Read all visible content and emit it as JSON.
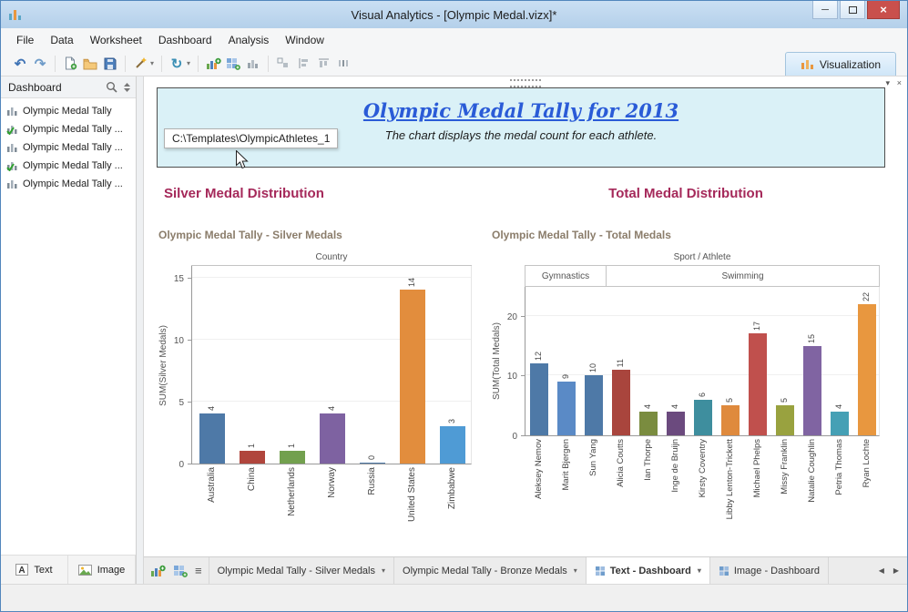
{
  "window": {
    "title": "Visual Analytics - [Olympic Medal.vizx]*"
  },
  "icons": {
    "caret_down": "▾",
    "minimize": "─",
    "close": "×",
    "undo": "↶",
    "redo": "↷",
    "refresh": "↻",
    "nav_left": "◀",
    "nav_right": "▶",
    "list": "≡"
  },
  "menu": {
    "items": [
      "File",
      "Data",
      "Worksheet",
      "Dashboard",
      "Analysis",
      "Window"
    ]
  },
  "toolbar": {
    "visualization_label": "Visualization"
  },
  "sidebar": {
    "title": "Dashboard",
    "items": [
      {
        "label": "Olympic Medal Tally",
        "checked": false
      },
      {
        "label": "Olympic Medal Tally ...",
        "checked": true
      },
      {
        "label": "Olympic Medal Tally ...",
        "checked": false
      },
      {
        "label": "Olympic Medal Tally ...",
        "checked": true
      },
      {
        "label": "Olympic Medal Tally ...",
        "checked": false
      }
    ],
    "footer": {
      "text_button": "Text",
      "image_button": "Image"
    }
  },
  "dashboard": {
    "text_widget": {
      "title": "Olympic Medal Tally for 2013",
      "subtitle": "The chart displays the medal count for each athlete."
    },
    "tooltip": "C:\\Templates\\OlympicAthletes_1",
    "sections": [
      {
        "heading": "Silver Medal Distribution"
      },
      {
        "heading": "Total Medal Distribution"
      }
    ]
  },
  "chart_data": [
    {
      "type": "bar",
      "title": "Olympic Medal Tally - Silver Medals",
      "top_axis_label": "Country",
      "ylabel": "SUM(Silver Medals)",
      "yticks": [
        0,
        5,
        10,
        15
      ],
      "ylim": [
        0,
        16
      ],
      "grid": true,
      "categories": [
        "Australia",
        "China",
        "Netherlands",
        "Norway",
        "Russia",
        "United States",
        "Zimbabwe"
      ],
      "values": [
        4,
        1,
        1,
        4,
        0,
        14,
        3
      ],
      "bar_colors": [
        "#4e79a7",
        "#b0453c",
        "#72a04e",
        "#7e62a1",
        "#4e79a7",
        "#e28d3d",
        "#4f9bd5"
      ]
    },
    {
      "type": "bar",
      "title": "Olympic Medal Tally - Total Medals",
      "top_axis_label": "Sport / Athlete",
      "ylabel": "SUM(Total Medals)",
      "yticks": [
        0,
        10,
        20
      ],
      "ylim": [
        0,
        25
      ],
      "grid": true,
      "groups": [
        {
          "label": "Gymnastics",
          "span": 3
        },
        {
          "label": "Swimming",
          "span": 10
        }
      ],
      "categories": [
        "Aleksey Nemov",
        "Marit Bjergen",
        "Sun Yang",
        "Alicia Coutts",
        "Ian Thorpe",
        "Inge de Bruijn",
        "Kirsty Coventry",
        "Libby Lenton-Trickett",
        "Michael Phelps",
        "Missy Franklin",
        "Natalie Coughlin",
        "Petria Thomas",
        "Ryan Lochte"
      ],
      "values": [
        12,
        9,
        10,
        11,
        4,
        4,
        6,
        5,
        17,
        5,
        15,
        4,
        22
      ],
      "bar_colors": [
        "#4e79a7",
        "#5a8ac6",
        "#4e79a7",
        "#a9453d",
        "#7a8c3f",
        "#6b4a7e",
        "#3e8e9e",
        "#df8a3d",
        "#c0504d",
        "#99a23f",
        "#8064a2",
        "#45a0b5",
        "#e8973f"
      ]
    }
  ],
  "tab_bar": {
    "tabs": [
      {
        "label": "Olympic Medal Tally - Silver Medals",
        "active": false,
        "icon": null,
        "caret": true
      },
      {
        "label": "Olympic Medal Tally - Bronze Medals",
        "active": false,
        "icon": null,
        "caret": true
      },
      {
        "label": "Text - Dashboard",
        "active": true,
        "icon": "grid-icon",
        "caret": true
      },
      {
        "label": "Image - Dashboard",
        "active": false,
        "icon": "grid-icon",
        "caret": false
      }
    ]
  }
}
